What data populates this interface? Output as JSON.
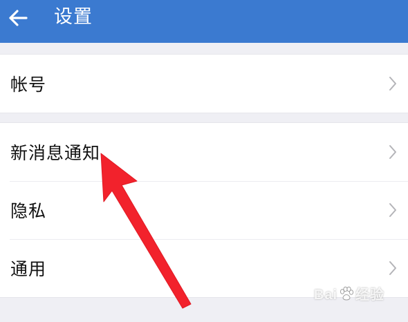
{
  "header": {
    "title": "设置",
    "background_color": "#3b7ad0",
    "back_icon": "arrow-left-icon"
  },
  "groups": [
    {
      "items": [
        {
          "label": "帐号",
          "icon": "chevron-right-icon"
        }
      ]
    },
    {
      "items": [
        {
          "label": "新消息通知",
          "icon": "chevron-right-icon"
        },
        {
          "label": "隐私",
          "icon": "chevron-right-icon"
        },
        {
          "label": "通用",
          "icon": "chevron-right-icon"
        }
      ]
    }
  ],
  "annotation": {
    "type": "red-arrow",
    "color": "#f2222c",
    "points_to": "新消息通知"
  },
  "watermark": {
    "text_left": "Bai",
    "text_right": "经验",
    "icon": "baidu-paw-icon"
  }
}
